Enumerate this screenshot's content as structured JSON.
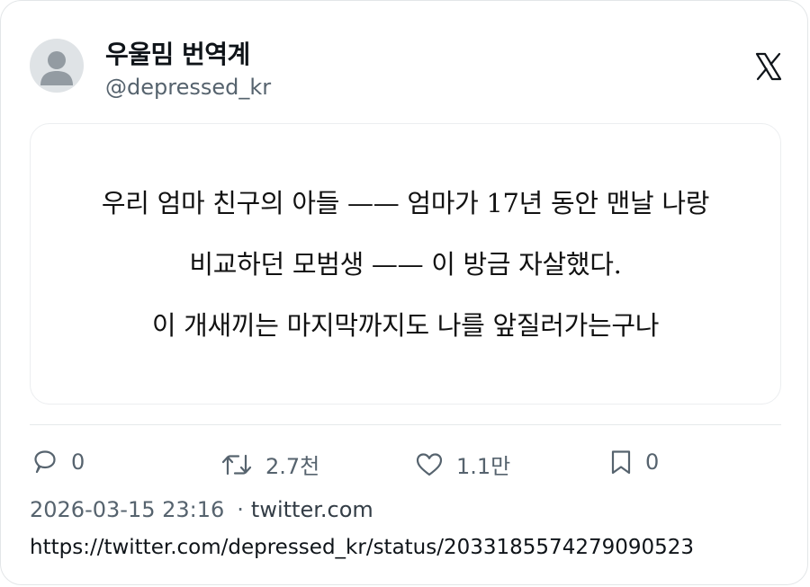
{
  "author": {
    "display_name": "우울밈 번역계",
    "handle": "@depressed_kr"
  },
  "brand_icon": "x-logo-icon",
  "post": {
    "lines": [
      "우리 엄마 친구의 아들 —— 엄마가 17년 동안 맨날 나랑",
      "비교하던 모범생 —— 이 방금 자살했다.",
      "이 개새끼는 마지막까지도 나를 앞질러가는구나"
    ]
  },
  "actions": {
    "reply": {
      "icon": "reply-icon",
      "count": "0"
    },
    "retweet": {
      "icon": "retweet-icon",
      "count": "2.7천"
    },
    "like": {
      "icon": "heart-icon",
      "count": "1.1만"
    },
    "bookmark": {
      "icon": "bookmark-icon",
      "count": "0"
    }
  },
  "meta": {
    "timestamp": "2026-03-15 23:16",
    "separator": "·",
    "source": "twitter.com",
    "url": "https://twitter.com/depressed_kr/status/2033185574279090523"
  },
  "colors": {
    "text": "#0f1419",
    "secondary": "#56636e",
    "border": "#e3e6e8",
    "avatar_bg": "#dfe3e6",
    "avatar_fg": "#939ba2"
  }
}
